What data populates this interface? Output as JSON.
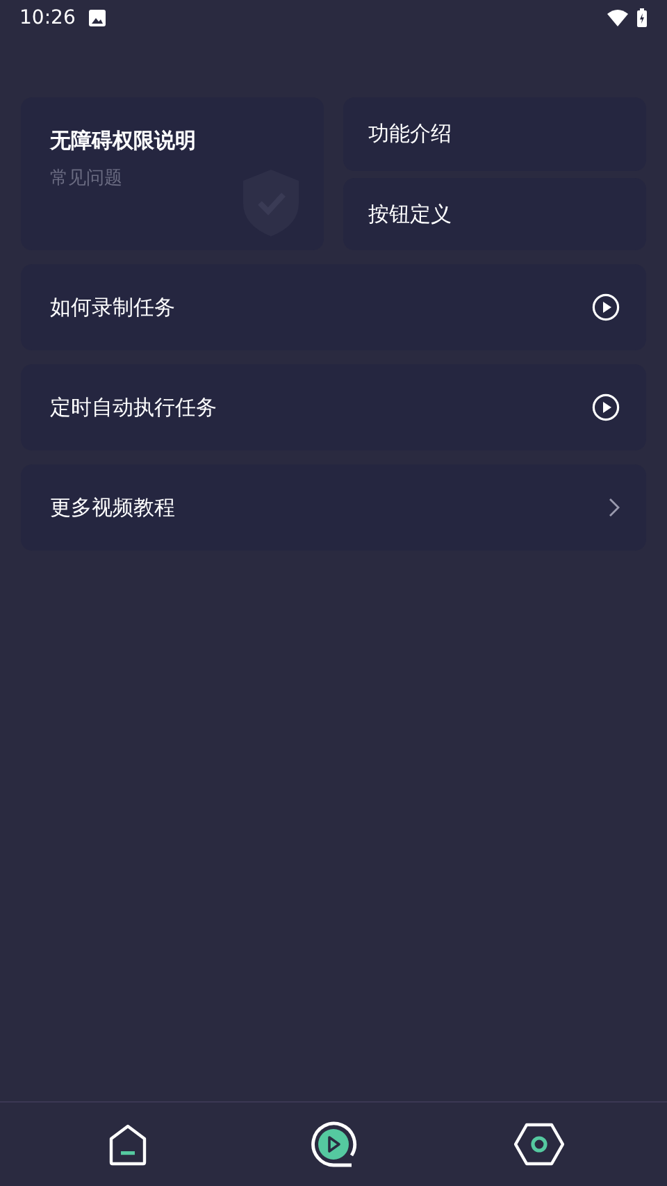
{
  "status_bar": {
    "time": "10:26"
  },
  "feature_card": {
    "title": "无障碍权限说明",
    "subtitle": "常见问题"
  },
  "side_buttons": [
    "功能介绍",
    "按钮定义"
  ],
  "list": [
    {
      "label": "如何录制任务",
      "kind": "video"
    },
    {
      "label": "定时自动执行任务",
      "kind": "video"
    },
    {
      "label": "更多视频教程",
      "kind": "link"
    }
  ],
  "bottom_nav": [
    {
      "kind": "home",
      "selected": false
    },
    {
      "kind": "tutorials",
      "selected": true
    },
    {
      "kind": "settings",
      "selected": false
    }
  ]
}
